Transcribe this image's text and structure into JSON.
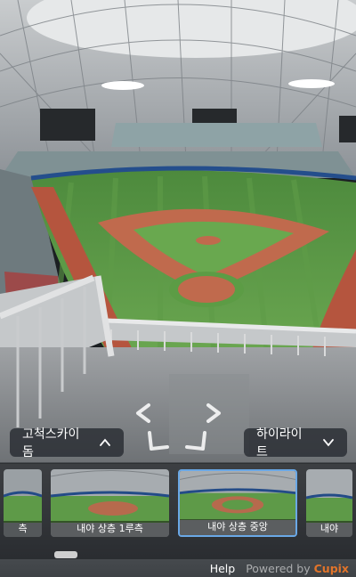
{
  "viewer": {
    "location_dropdown": "고척스카이돔",
    "highlight_dropdown": "하이라이트",
    "thumbnails": [
      {
        "label": "측",
        "active": false
      },
      {
        "label": "내야 상층 1루측",
        "active": false
      },
      {
        "label": "내야 상층 중앙",
        "active": true
      },
      {
        "label": "내야",
        "active": false
      }
    ]
  },
  "footer": {
    "help": "Help",
    "powered_by": "Powered by",
    "brand": "Cupix"
  },
  "colors": {
    "accent_border": "#6aa8e6",
    "brand": "#e2742a"
  }
}
